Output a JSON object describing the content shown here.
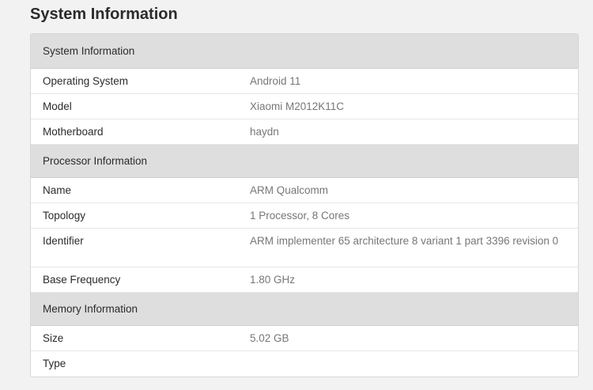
{
  "page": {
    "title": "System Information"
  },
  "sections": [
    {
      "header": "System Information",
      "rows": [
        {
          "key": "Operating System",
          "value": "Android 11"
        },
        {
          "key": "Model",
          "value": "Xiaomi M2012K11C"
        },
        {
          "key": "Motherboard",
          "value": "haydn"
        }
      ]
    },
    {
      "header": "Processor Information",
      "rows": [
        {
          "key": "Name",
          "value": "ARM Qualcomm"
        },
        {
          "key": "Topology",
          "value": "1 Processor, 8 Cores"
        },
        {
          "key": "Identifier",
          "value": "ARM implementer 65 architecture 8 variant 1 part 3396 revision 0"
        },
        {
          "key": "Base Frequency",
          "value": "1.80 GHz"
        }
      ]
    },
    {
      "header": "Memory Information",
      "rows": [
        {
          "key": "Size",
          "value": "5.02 GB"
        },
        {
          "key": "Type",
          "value": ""
        }
      ]
    }
  ],
  "colors": {
    "page_background": "#f2f2f2",
    "section_header_background": "#dedede",
    "row_background": "#ffffff",
    "key_text": "#2b2b2b",
    "value_text": "#777777"
  }
}
